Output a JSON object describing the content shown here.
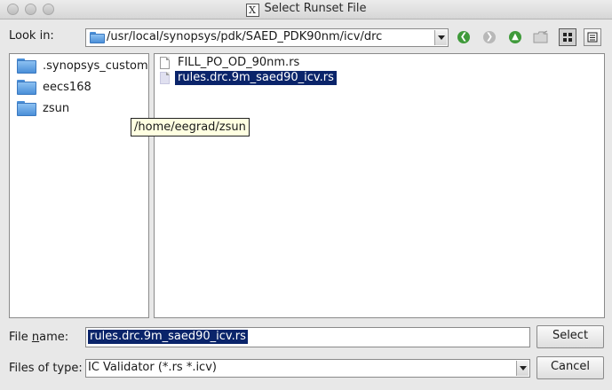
{
  "window": {
    "title": "Select Runset File",
    "app_logo": "X"
  },
  "look_in": {
    "label": "Look in:",
    "path": "/usr/local/synopsys/pdk/SAED_PDK90nm/icv/drc"
  },
  "nav_icons": [
    "back-icon",
    "forward-icon",
    "up-folder-icon",
    "new-folder-icon",
    "icon-view-icon",
    "list-view-icon"
  ],
  "places": [
    {
      "name": ".synopsys_custom"
    },
    {
      "name": "eecs168"
    },
    {
      "name": "zsun"
    }
  ],
  "tooltip": "/home/eegrad/zsun",
  "files": [
    {
      "name": "FILL_PO_OD_90nm.rs",
      "selected": false
    },
    {
      "name": "rules.drc.9m_saed90_icv.rs",
      "selected": true
    }
  ],
  "file_name": {
    "label_pre": "File ",
    "label_u": "n",
    "label_post": "ame:",
    "value": "rules.drc.9m_saed90_icv.rs"
  },
  "file_type": {
    "label": "Files of type:",
    "value": "IC Validator (*.rs *.icv)"
  },
  "buttons": {
    "select": "Select",
    "cancel": "Cancel"
  },
  "colors": {
    "selection": "#0a246a",
    "tooltip_bg": "#ffffe1",
    "folder": "#4a8fd8"
  }
}
